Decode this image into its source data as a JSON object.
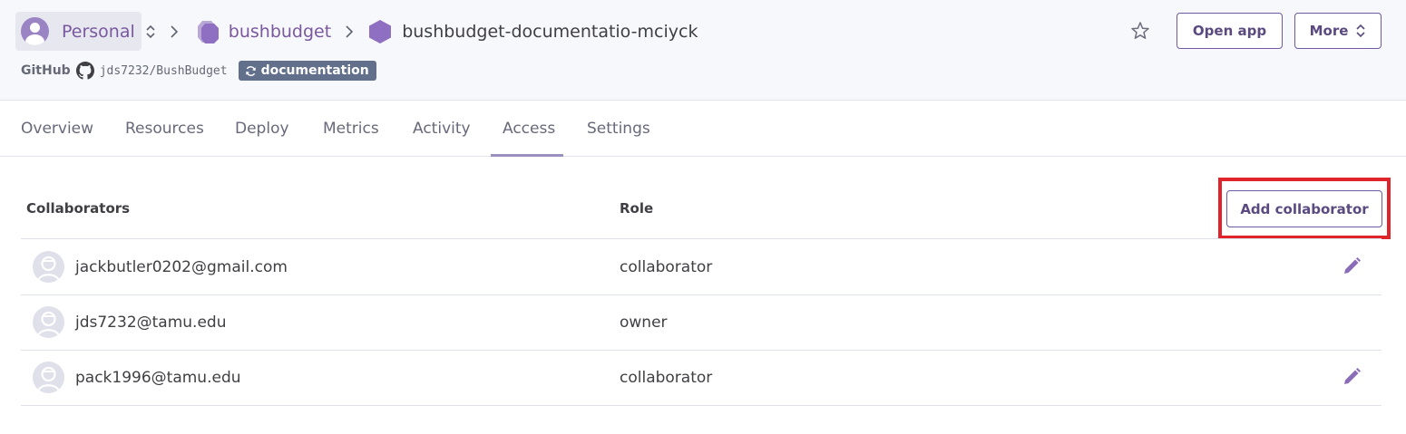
{
  "header": {
    "account_label": "Personal",
    "pipeline_name": "bushbudget",
    "app_name": "bushbudget-documentatio-mciyck",
    "open_app_label": "Open app",
    "more_label": "More",
    "github_label": "GitHub",
    "repo": "jds7232/BushBudget",
    "branch": "documentation"
  },
  "tabs": [
    {
      "label": "Overview"
    },
    {
      "label": "Resources"
    },
    {
      "label": "Deploy"
    },
    {
      "label": "Metrics"
    },
    {
      "label": "Activity"
    },
    {
      "label": "Access",
      "active": true
    },
    {
      "label": "Settings"
    }
  ],
  "table": {
    "col_collaborators": "Collaborators",
    "col_role": "Role",
    "add_label": "Add collaborator",
    "rows": [
      {
        "email": "jackbutler0202@gmail.com",
        "role": "collaborator",
        "editable": true
      },
      {
        "email": "jds7232@tamu.edu",
        "role": "owner",
        "editable": false
      },
      {
        "email": "pack1996@tamu.edu",
        "role": "collaborator",
        "editable": true
      }
    ]
  },
  "colors": {
    "accent": "#79589f",
    "highlight_box": "#e0242b",
    "branch_badge": "#62708b"
  },
  "icons": [
    "avatar",
    "chevron-updown-icon",
    "chevron-right-icon",
    "pipeline-icon",
    "app-hexagon-icon",
    "star-icon",
    "github-icon",
    "sync-icon",
    "user-avatar-icon",
    "pencil-edit-icon"
  ]
}
